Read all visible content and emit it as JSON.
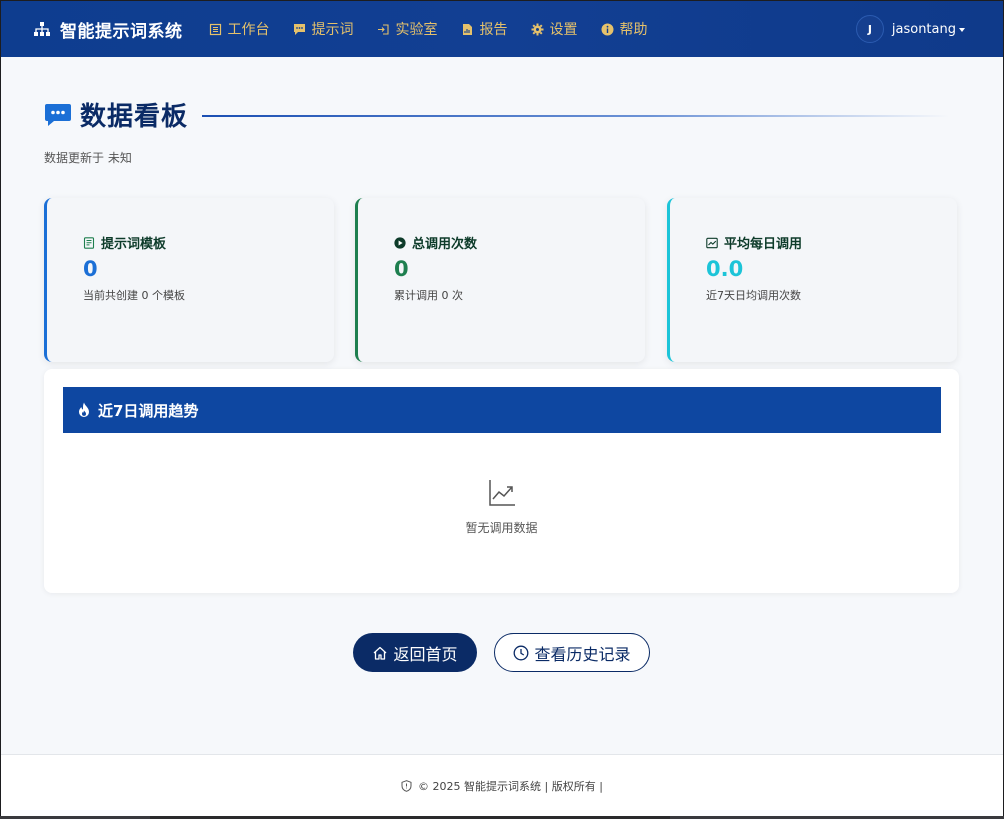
{
  "app": {
    "brand": "智能提示词系统"
  },
  "nav": [
    {
      "label": "工作台",
      "icon": "workbench-icon"
    },
    {
      "label": "提示词",
      "icon": "chat-icon"
    },
    {
      "label": "实验室",
      "icon": "enter-icon"
    },
    {
      "label": "报告",
      "icon": "report-icon"
    },
    {
      "label": "设置",
      "icon": "gear-icon"
    },
    {
      "label": "帮助",
      "icon": "info-icon"
    }
  ],
  "user": {
    "initial": "J",
    "name": "jasontang"
  },
  "page": {
    "title": "数据看板",
    "updated": "数据更新于 未知"
  },
  "cards": [
    {
      "title": "提示词模板",
      "value": "0",
      "desc": "当前共创建 0 个模板",
      "icon": "document-icon"
    },
    {
      "title": "总调用次数",
      "value": "0",
      "desc": "累计调用 0 次",
      "icon": "play-circle-icon"
    },
    {
      "title": "平均每日调用",
      "value": "0.0",
      "desc": "近7天日均调用次数",
      "icon": "chart-line-icon"
    }
  ],
  "trend": {
    "title": "近7日调用趋势",
    "empty": "暂无调用数据",
    "icon": "fire-icon"
  },
  "buttons": {
    "home": "返回首页",
    "history": "查看历史记录"
  },
  "footer": {
    "text": "© 2025 智能提示词系统 | 版权所有 |"
  },
  "colors": {
    "navbar": "#0e3d8f",
    "accent_gold": "#e5c16b",
    "primary": "#0b2b66",
    "card_blue": "#1b6fd6",
    "card_green": "#1e7f4f",
    "card_cyan": "#1cc4d8",
    "trend_header": "#0e47a1"
  }
}
